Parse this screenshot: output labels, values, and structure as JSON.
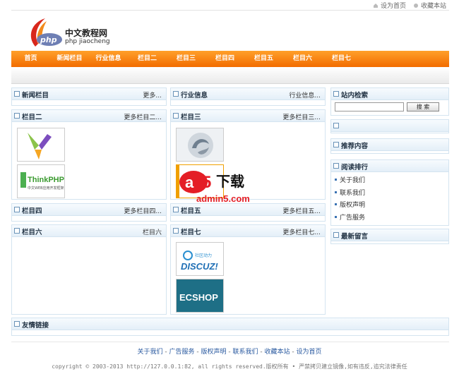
{
  "top_links": [
    "设为首页",
    "收藏本站"
  ],
  "logo": {
    "mark": "php",
    "title": "中文教程网",
    "subtitle": "php jiaocheng"
  },
  "nav": [
    "首页",
    "新闻栏目",
    "行业信息",
    "栏目二",
    "栏目三",
    "栏目四",
    "栏目五",
    "栏目六",
    "栏目七"
  ],
  "boxes": {
    "news": {
      "title": "新闻栏目",
      "more": "更多..."
    },
    "industry": {
      "title": "行业信息",
      "more": "行业信息..."
    },
    "col2": {
      "title": "栏目二",
      "more": "更多栏目二..."
    },
    "col3": {
      "title": "栏目三",
      "more": "更多栏目三..."
    },
    "col4": {
      "title": "栏目四",
      "more": "更多栏目四..."
    },
    "col5": {
      "title": "栏目五",
      "more": "更多栏目五..."
    },
    "col6": {
      "title": "栏目六",
      "more": "栏目六"
    },
    "col7": {
      "title": "栏目七",
      "more": "更多栏目七..."
    },
    "friends": {
      "title": "友情链接"
    }
  },
  "thumbs": {
    "thinkphp_text": "ThinkPHP",
    "thinkphp_sub": "中文WEB应用开发框架",
    "discuz_top": "社区动力",
    "discuz": "DISCUZ!",
    "ecshop": "ECSHOP"
  },
  "sidebar": {
    "search_title": "站内检索",
    "search_button": "搜 索",
    "recommend_title": "推荐内容",
    "rank_title": "阅读排行",
    "rank_items": [
      "关于我们",
      "联系我们",
      "版权声明",
      "广告服务"
    ],
    "messages_title": "最新留言"
  },
  "watermark": {
    "brand": "下载",
    "domain": "admin5.com"
  },
  "footer": {
    "links": [
      "关于我们",
      "广告服务",
      "版权声明",
      "联系我们",
      "收藏本站",
      "设为首页"
    ],
    "copyright": "copyright © 2003-2013 http://127.0.0.1:82, all rights reserved.版权所有 • 严禁拷贝建立镜像,如有违反,追究法律责任"
  },
  "colors": {
    "nav": "#f26c00",
    "box_border": "#d4e4f0",
    "link": "#2a5aa0"
  }
}
